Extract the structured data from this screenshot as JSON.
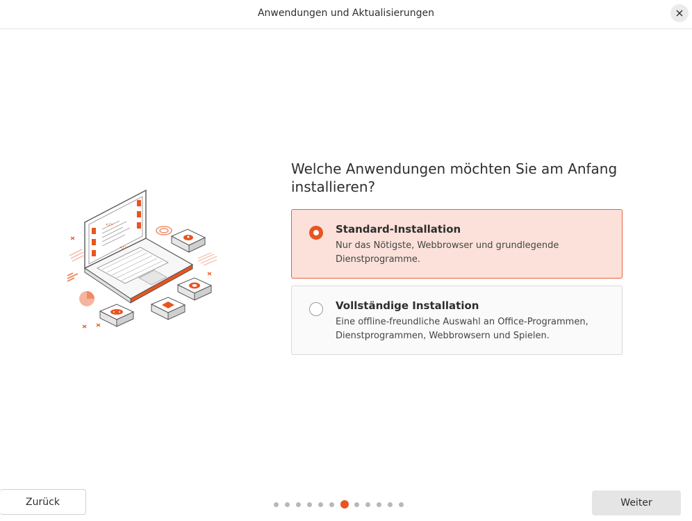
{
  "window": {
    "title": "Anwendungen und Aktualisierungen"
  },
  "icons": {
    "close": "close-icon",
    "illustration": "laptop-apps-illustration"
  },
  "colors": {
    "accent": "#e95420",
    "selected_background": "#fbe1d9"
  },
  "main": {
    "question": "Welche Anwendungen möchten Sie am Anfang installieren?",
    "options": [
      {
        "title": "Standard-Installation",
        "description": "Nur das Nötigste, Webbrowser und grundlegende Dienstprogramme.",
        "selected": true
      },
      {
        "title": "Vollständige Installation",
        "description": "Eine offline-freundliche Auswahl an Office-Programmen, Dienstprogrammen, Webbrowsern und Spielen.",
        "selected": false
      }
    ]
  },
  "footer": {
    "back_label": "Zurück",
    "next_label": "Weiter",
    "progress": {
      "total_steps": 12,
      "current_step": 7
    }
  }
}
